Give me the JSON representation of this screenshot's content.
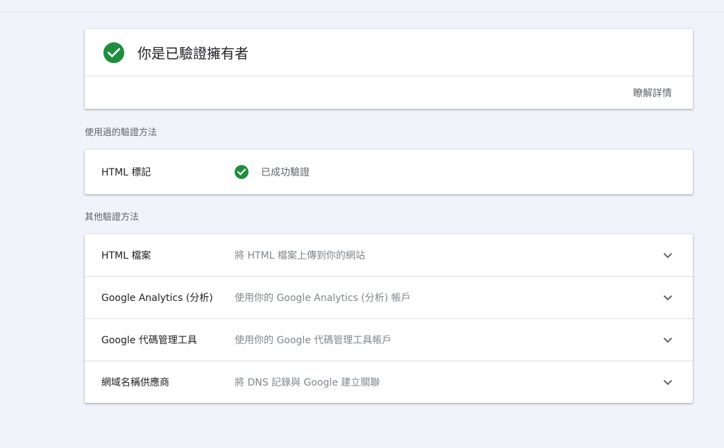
{
  "owner": {
    "title": "你是已驗證擁有者",
    "learn_more": "瞭解詳情"
  },
  "used_methods": {
    "label": "使用過的驗證方法",
    "items": [
      {
        "name": "HTML 標記",
        "status": "已成功驗證"
      }
    ]
  },
  "other_methods": {
    "label": "其他驗證方法",
    "items": [
      {
        "name": "HTML 檔案",
        "description": "將 HTML 檔案上傳到你的網站"
      },
      {
        "name": "Google Analytics (分析)",
        "description": "使用你的 Google Analytics (分析) 帳戶"
      },
      {
        "name": "Google 代碼管理工具",
        "description": "使用你的 Google 代碼管理工具帳戶"
      },
      {
        "name": "網域名稱供應商",
        "description": "將 DNS 記錄與 Google 建立關聯"
      }
    ]
  },
  "icons": {
    "verified": "check-circle-icon",
    "expand": "chevron-down-icon"
  },
  "colors": {
    "success": "#1e8e3e",
    "background": "#f1f3fb"
  }
}
